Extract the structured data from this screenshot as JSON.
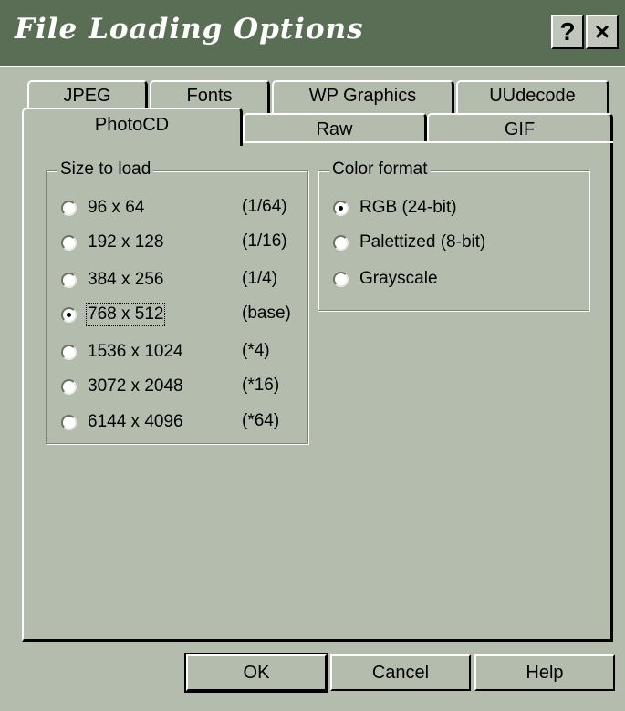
{
  "window": {
    "title": "File Loading Options",
    "help_button": "?",
    "close_button": "×"
  },
  "tabs": {
    "back_row": [
      "JPEG",
      "Fonts",
      "WP Graphics",
      "UUdecode"
    ],
    "front_row": [
      "PhotoCD",
      "Raw",
      "GIF"
    ],
    "selected": "PhotoCD"
  },
  "size_group": {
    "legend": "Size to load",
    "options": [
      {
        "label": "96 x 64",
        "ratio": "(1/64)",
        "selected": false
      },
      {
        "label": "192 x 128",
        "ratio": "(1/16)",
        "selected": false
      },
      {
        "label": "384 x 256",
        "ratio": "(1/4)",
        "selected": false
      },
      {
        "label": "768 x 512",
        "ratio": "(base)",
        "selected": true
      },
      {
        "label": "1536 x 1024",
        "ratio": "(*4)",
        "selected": false
      },
      {
        "label": "3072 x 2048",
        "ratio": "(*16)",
        "selected": false
      },
      {
        "label": "6144 x 4096",
        "ratio": "(*64)",
        "selected": false
      }
    ]
  },
  "color_group": {
    "legend": "Color format",
    "options": [
      {
        "label": "RGB (24-bit)",
        "selected": true
      },
      {
        "label": "Palettized (8-bit)",
        "selected": false
      },
      {
        "label": "Grayscale",
        "selected": false
      }
    ]
  },
  "buttons": {
    "ok": "OK",
    "cancel": "Cancel",
    "help": "Help"
  },
  "colors": {
    "face": "#b4bdad",
    "titlebar": "#5a6e55",
    "title_text": "#ffffff"
  }
}
